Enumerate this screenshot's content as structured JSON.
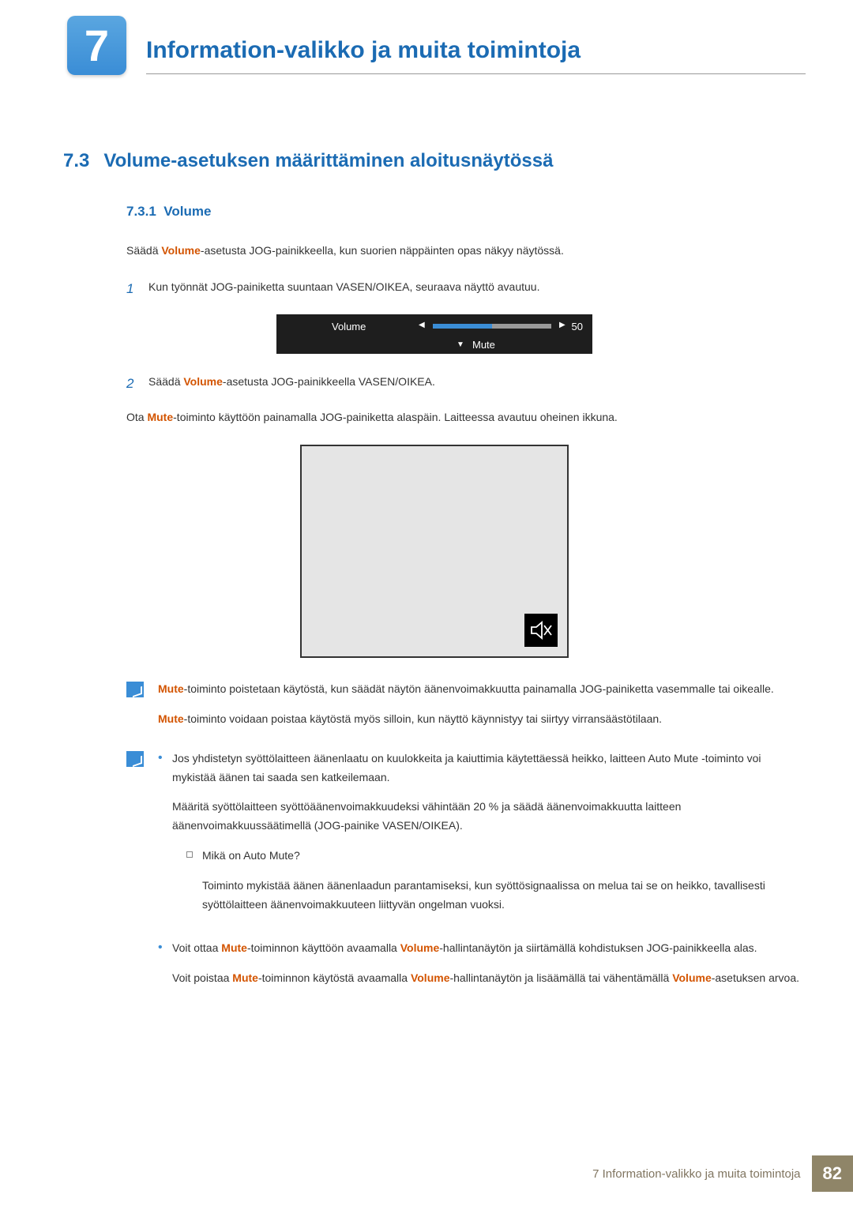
{
  "chapter": {
    "number": "7",
    "title": "Information-valikko ja muita toimintoja"
  },
  "section": {
    "number": "7.3",
    "title": "Volume-asetuksen määrittäminen aloitusnäytössä"
  },
  "subsection": {
    "number": "7.3.1",
    "title": "Volume"
  },
  "intro": {
    "prefix": "Säädä ",
    "hl": "Volume",
    "suffix": "-asetusta JOG-painikkeella, kun suorien näppäinten opas näkyy näytössä."
  },
  "step1": {
    "num": "1",
    "text": "Kun työnnät JOG-painiketta suuntaan VASEN/OIKEA, seuraava näyttö avautuu."
  },
  "osd": {
    "label": "Volume",
    "value": "50",
    "mute": "Mute",
    "fill_percent": 50
  },
  "step2": {
    "num": "2",
    "prefix": "Säädä ",
    "hl": "Volume",
    "suffix": "-asetusta JOG-painikkeella VASEN/OIKEA."
  },
  "mute_intro": {
    "prefix": "Ota ",
    "hl": "Mute",
    "suffix": "-toiminto käyttöön painamalla JOG-painiketta alaspäin. Laitteessa avautuu oheinen ikkuna."
  },
  "note1": {
    "p1_hl": "Mute",
    "p1_rest": "-toiminto poistetaan käytöstä, kun säädät näytön äänenvoimakkuutta painamalla JOG-painiketta vasemmalle tai oikealle.",
    "p2_hl": "Mute",
    "p2_rest": "-toiminto voidaan poistaa käytöstä myös silloin, kun näyttö käynnistyy tai siirtyy virransäästötilaan."
  },
  "note2": {
    "b1_p1": "Jos yhdistetyn syöttölaitteen äänenlaatu on kuulokkeita ja kaiuttimia käytettäessä heikko, laitteen Auto Mute -toiminto voi mykistää äänen tai saada sen katkeilemaan.",
    "b1_p2": "Määritä syöttölaitteen syöttöäänenvoimakkuudeksi vähintään 20 % ja säädä äänenvoimakkuutta laitteen äänenvoimakkuussäätimellä (JOG-painike VASEN/OIKEA).",
    "sub_q": "Mikä on Auto Mute?",
    "sub_a": "Toiminto mykistää äänen äänenlaadun parantamiseksi, kun syöttösignaalissa on melua tai se on heikko, tavallisesti syöttölaitteen äänenvoimakkuuteen liittyvän ongelman vuoksi.",
    "b2_t1": "Voit ottaa ",
    "b2_hl1": "Mute",
    "b2_t2": "-toiminnon käyttöön avaamalla ",
    "b2_hl2": "Volume",
    "b2_t3": "-hallintanäytön ja siirtämällä kohdistuksen JOG-painikkeella alas.",
    "b2_t4": "Voit poistaa ",
    "b2_hl3": "Mute",
    "b2_t5": "-toiminnon käytöstä avaamalla ",
    "b2_hl4": "Volume",
    "b2_t6": "-hallintanäytön ja lisäämällä tai vähentämällä ",
    "b2_hl5": "Volume",
    "b2_t7": "-asetuksen arvoa."
  },
  "footer": {
    "text": "7 Information-valikko ja muita toimintoja",
    "page": "82"
  }
}
